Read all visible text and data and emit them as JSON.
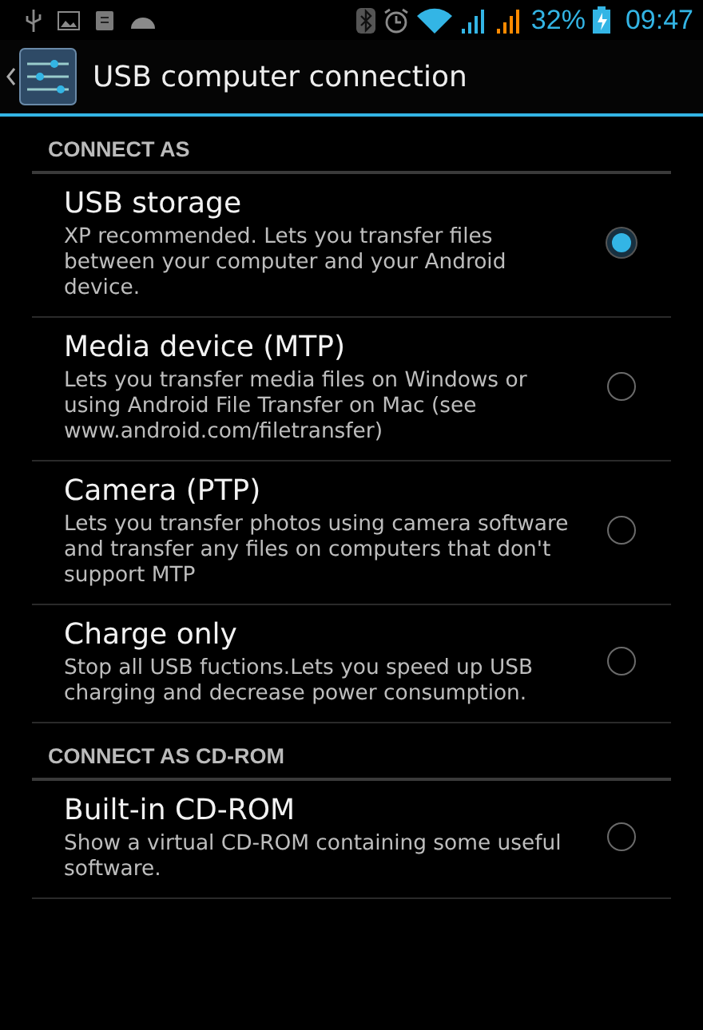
{
  "status_bar": {
    "battery_percent": "32%",
    "time": "09:47"
  },
  "action_bar": {
    "title": "USB computer connection"
  },
  "sections": [
    {
      "header": "CONNECT AS",
      "options": [
        {
          "title": "USB storage",
          "summary": "XP recommended. Lets you transfer files between your computer and your Android device.",
          "selected": true
        },
        {
          "title": "Media device (MTP)",
          "summary": "Lets you transfer media files on Windows or using Android File Transfer on Mac (see www.android.com/filetransfer)",
          "selected": false
        },
        {
          "title": "Camera (PTP)",
          "summary": "Lets you transfer photos using camera software and transfer any files on computers that don't support MTP",
          "selected": false
        },
        {
          "title": "Charge only",
          "summary": "Stop all USB fuctions.Lets you speed up USB charging and decrease power consumption.",
          "selected": false
        }
      ]
    },
    {
      "header": "CONNECT AS CD-ROM",
      "options": [
        {
          "title": "Built-in CD-ROM",
          "summary": "Show a virtual CD-ROM containing some useful software.",
          "selected": false
        }
      ]
    }
  ]
}
